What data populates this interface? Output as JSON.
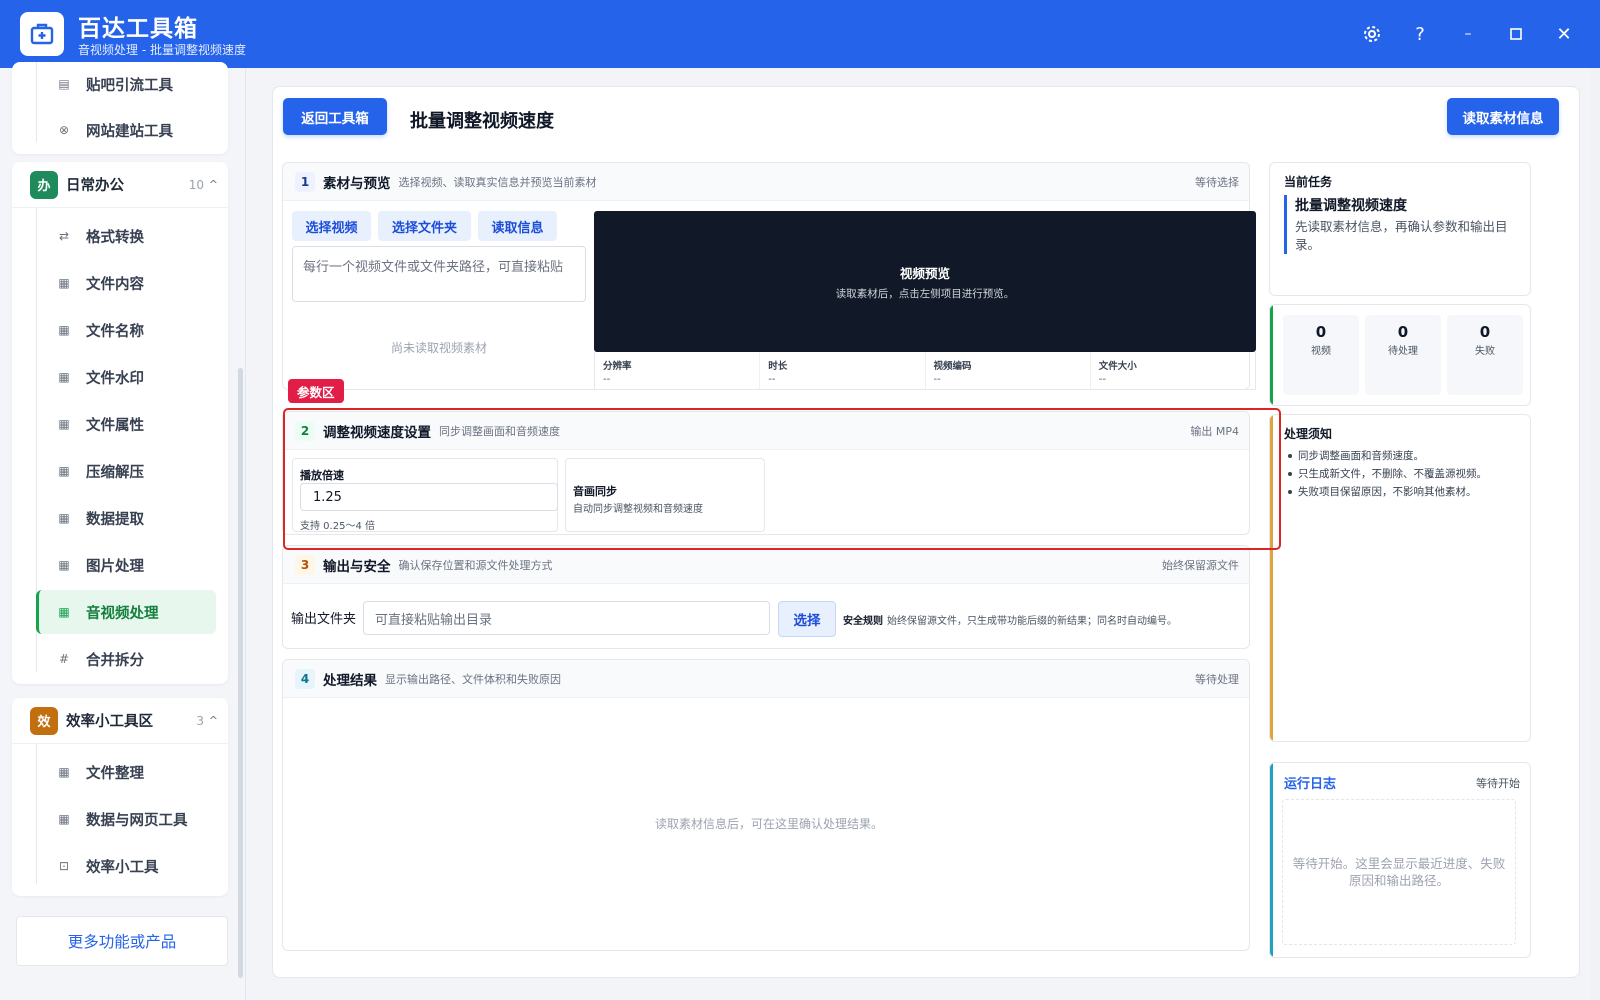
{
  "app": {
    "title": "百达工具箱",
    "subtitle": "音视频处理 - 批量调整视频速度",
    "accent_color": "#2563eb",
    "window_controls": [
      "settings-icon",
      "help-icon",
      "minimize-icon",
      "maximize-icon",
      "close-icon"
    ]
  },
  "sidebar": {
    "prev_group_items": [
      {
        "label": "贴吧引流工具",
        "icon": "doc-icon"
      },
      {
        "label": "网站建站工具",
        "icon": "globe-icon"
      }
    ],
    "office_group": {
      "badge": "办",
      "badge_color": "#1f8a5c",
      "name": "日常办公",
      "count": "10",
      "caret": "^",
      "items": [
        {
          "label": "格式转换",
          "icon": "swap-icon",
          "glyph": "⇄"
        },
        {
          "label": "文件内容",
          "icon": "grid-icon",
          "glyph": "▦"
        },
        {
          "label": "文件名称",
          "icon": "grid-icon",
          "glyph": "▦"
        },
        {
          "label": "文件水印",
          "icon": "grid-icon",
          "glyph": "▦"
        },
        {
          "label": "文件属性",
          "icon": "grid-icon",
          "glyph": "▦"
        },
        {
          "label": "压缩解压",
          "icon": "grid-icon",
          "glyph": "▦"
        },
        {
          "label": "数据提取",
          "icon": "grid-icon",
          "glyph": "▦"
        },
        {
          "label": "图片处理",
          "icon": "grid-icon",
          "glyph": "▦"
        },
        {
          "label": "音视频处理",
          "icon": "grid-icon",
          "glyph": "▦",
          "active": true
        },
        {
          "label": "合并拆分",
          "icon": "hash-icon",
          "glyph": "#"
        }
      ]
    },
    "efficiency_group": {
      "badge": "效",
      "badge_color": "#c2700f",
      "name": "效率小工具区",
      "count": "3",
      "caret": "^",
      "items": [
        {
          "label": "文件整理",
          "icon": "grid-icon",
          "glyph": "▦"
        },
        {
          "label": "数据与网页工具",
          "icon": "grid-icon",
          "glyph": "▦"
        },
        {
          "label": "效率小工具",
          "icon": "box-icon",
          "glyph": "⊡"
        }
      ]
    },
    "more_button": "更多功能或产品"
  },
  "header": {
    "back_button": "返回工具箱",
    "page_title": "批量调整视频速度",
    "read_info_button": "读取素材信息"
  },
  "section1": {
    "num": "1",
    "title": "素材与预览",
    "desc": "选择视频、读取真实信息并预览当前素材",
    "status": "等待选择",
    "buttons": [
      "选择视频",
      "选择文件夹",
      "读取信息"
    ],
    "input_placeholder": "每行一个视频文件或文件夹路径，可直接粘贴",
    "empty_text": "尚未读取视频素材",
    "preview_title": "视频预览",
    "preview_sub": "读取素材后，点击左侧项目进行预览。",
    "meta": [
      {
        "label": "分辨率",
        "value": "--"
      },
      {
        "label": "时长",
        "value": "--"
      },
      {
        "label": "视频编码",
        "value": "--"
      },
      {
        "label": "文件大小",
        "value": "--"
      }
    ]
  },
  "param_tag": "参数区",
  "section2": {
    "num": "2",
    "title": "调整视频速度设置",
    "desc": "同步调整画面和音频速度",
    "status": "输出 MP4",
    "speed_label": "播放倍速",
    "speed_value": "1.25",
    "speed_hint": "支持 0.25～4 倍",
    "sync_title": "音画同步",
    "sync_desc": "自动同步调整视频和音频速度"
  },
  "section3": {
    "num": "3",
    "title": "输出与安全",
    "desc": "确认保存位置和源文件处理方式",
    "status": "始终保留源文件",
    "out_label": "输出文件夹",
    "out_placeholder": "可直接粘贴输出目录",
    "choose_button": "选择",
    "safety_label": "安全规则",
    "safety_text": "始终保留源文件，只生成带功能后缀的新结果；同名时自动编号。"
  },
  "section4": {
    "num": "4",
    "title": "处理结果",
    "desc": "显示输出路径、文件体积和失败原因",
    "status": "等待处理",
    "empty_text": "读取素材信息后，可在这里确认处理结果。"
  },
  "right": {
    "task_heading": "当前任务",
    "task_name": "批量调整视频速度",
    "task_desc": "先读取素材信息，再确认参数和输出目录。",
    "stats": [
      {
        "value": "0",
        "label": "视频"
      },
      {
        "value": "0",
        "label": "待处理"
      },
      {
        "value": "0",
        "label": "失败"
      }
    ],
    "notice_heading": "处理须知",
    "notices": [
      "同步调整画面和音频速度。",
      "只生成新文件，不删除、不覆盖源视频。",
      "失败项目保留原因，不影响其他素材。"
    ],
    "log_heading": "运行日志",
    "log_status": "等待开始",
    "log_text": "等待开始。这里会显示最近进度、失败原因和输出路径。"
  }
}
